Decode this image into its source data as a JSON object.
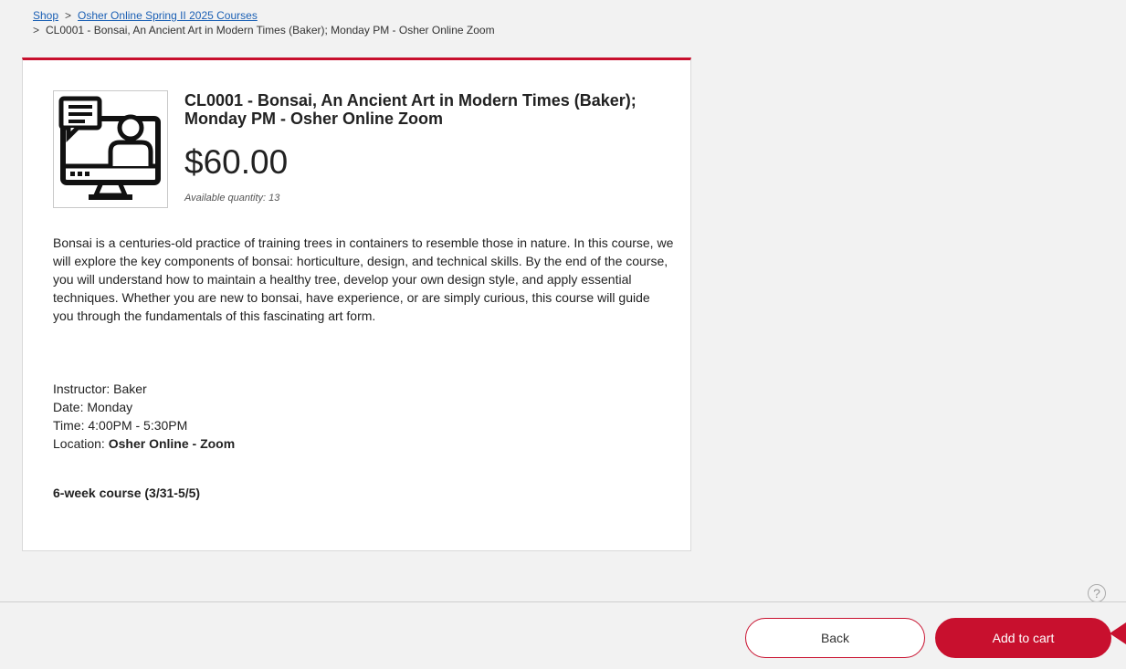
{
  "breadcrumb": {
    "shop": "Shop",
    "category": "Osher Online Spring II 2025 Courses",
    "current": "CL0001 - Bonsai, An Ancient Art in Modern Times (Baker); Monday PM - Osher Online Zoom",
    "separator": ">"
  },
  "product": {
    "title": "CL0001 - Bonsai, An Ancient Art in Modern Times (Baker); Monday PM - Osher Online Zoom",
    "price": "$60.00",
    "availability": "Available quantity: 13",
    "description": "Bonsai is a centuries-old practice of training trees in containers to resemble those in nature. In this course, we will explore the key components of bonsai: horticulture, design, and technical skills. By the end of the course, you will understand how to maintain a healthy tree, develop your own design style, and apply essential techniques. Whether you are new to bonsai, have experience, or are simply curious, this course will guide you through the fundamentals of this fascinating art form.",
    "instructor": "Instructor: Baker",
    "date": "Date: Monday",
    "time": "Time: 4:00PM - 5:30PM",
    "location_label": "Location: ",
    "location_value": "Osher Online - Zoom",
    "duration": "6-week course (3/31-5/5)",
    "image_icon": "online-class-monitor-icon"
  },
  "footer": {
    "help": "?",
    "back_label": "Back",
    "add_label": "Add to cart"
  },
  "colors": {
    "accent": "#c8102e",
    "link": "#1a5fb4",
    "background": "#f2f2f2"
  }
}
